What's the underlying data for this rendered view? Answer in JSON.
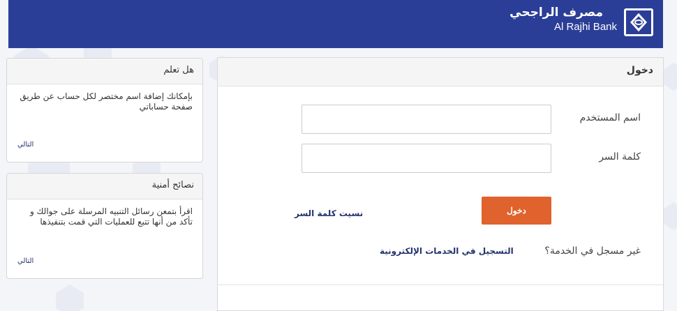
{
  "header": {
    "bank_name_ar": "مصرف الراجحي",
    "bank_name_en": "Al Rajhi Bank",
    "brand_color": "#2b3e97",
    "logo_icon": "bank-logo-icon"
  },
  "login": {
    "title": "دخول",
    "username_label": "اسم المستخدم",
    "username_value": "",
    "password_label": "كلمة السر",
    "password_value": "",
    "login_button": "دخول",
    "forgot_password": "نسيت كلمة السر",
    "not_registered": "غير مسجل في الخدمة؟",
    "register_link": "التسجيل في الخدمات الإلكترونية",
    "accent_color": "#e0622d"
  },
  "did_you_know": {
    "title": "هل تعلم",
    "body": "بإمكانك إضافة اسم مختصر لكل حساب عن طريق صفحة حساباتي",
    "next": "التالي"
  },
  "security_tips": {
    "title": "نصائح أمنية",
    "body": "اقرأ بتمعن رسائل التنبيه المرسلة على جوالك و تأكد من أنها تتبع للعمليات التي قمت بتنفيذها",
    "next": "التالي"
  }
}
